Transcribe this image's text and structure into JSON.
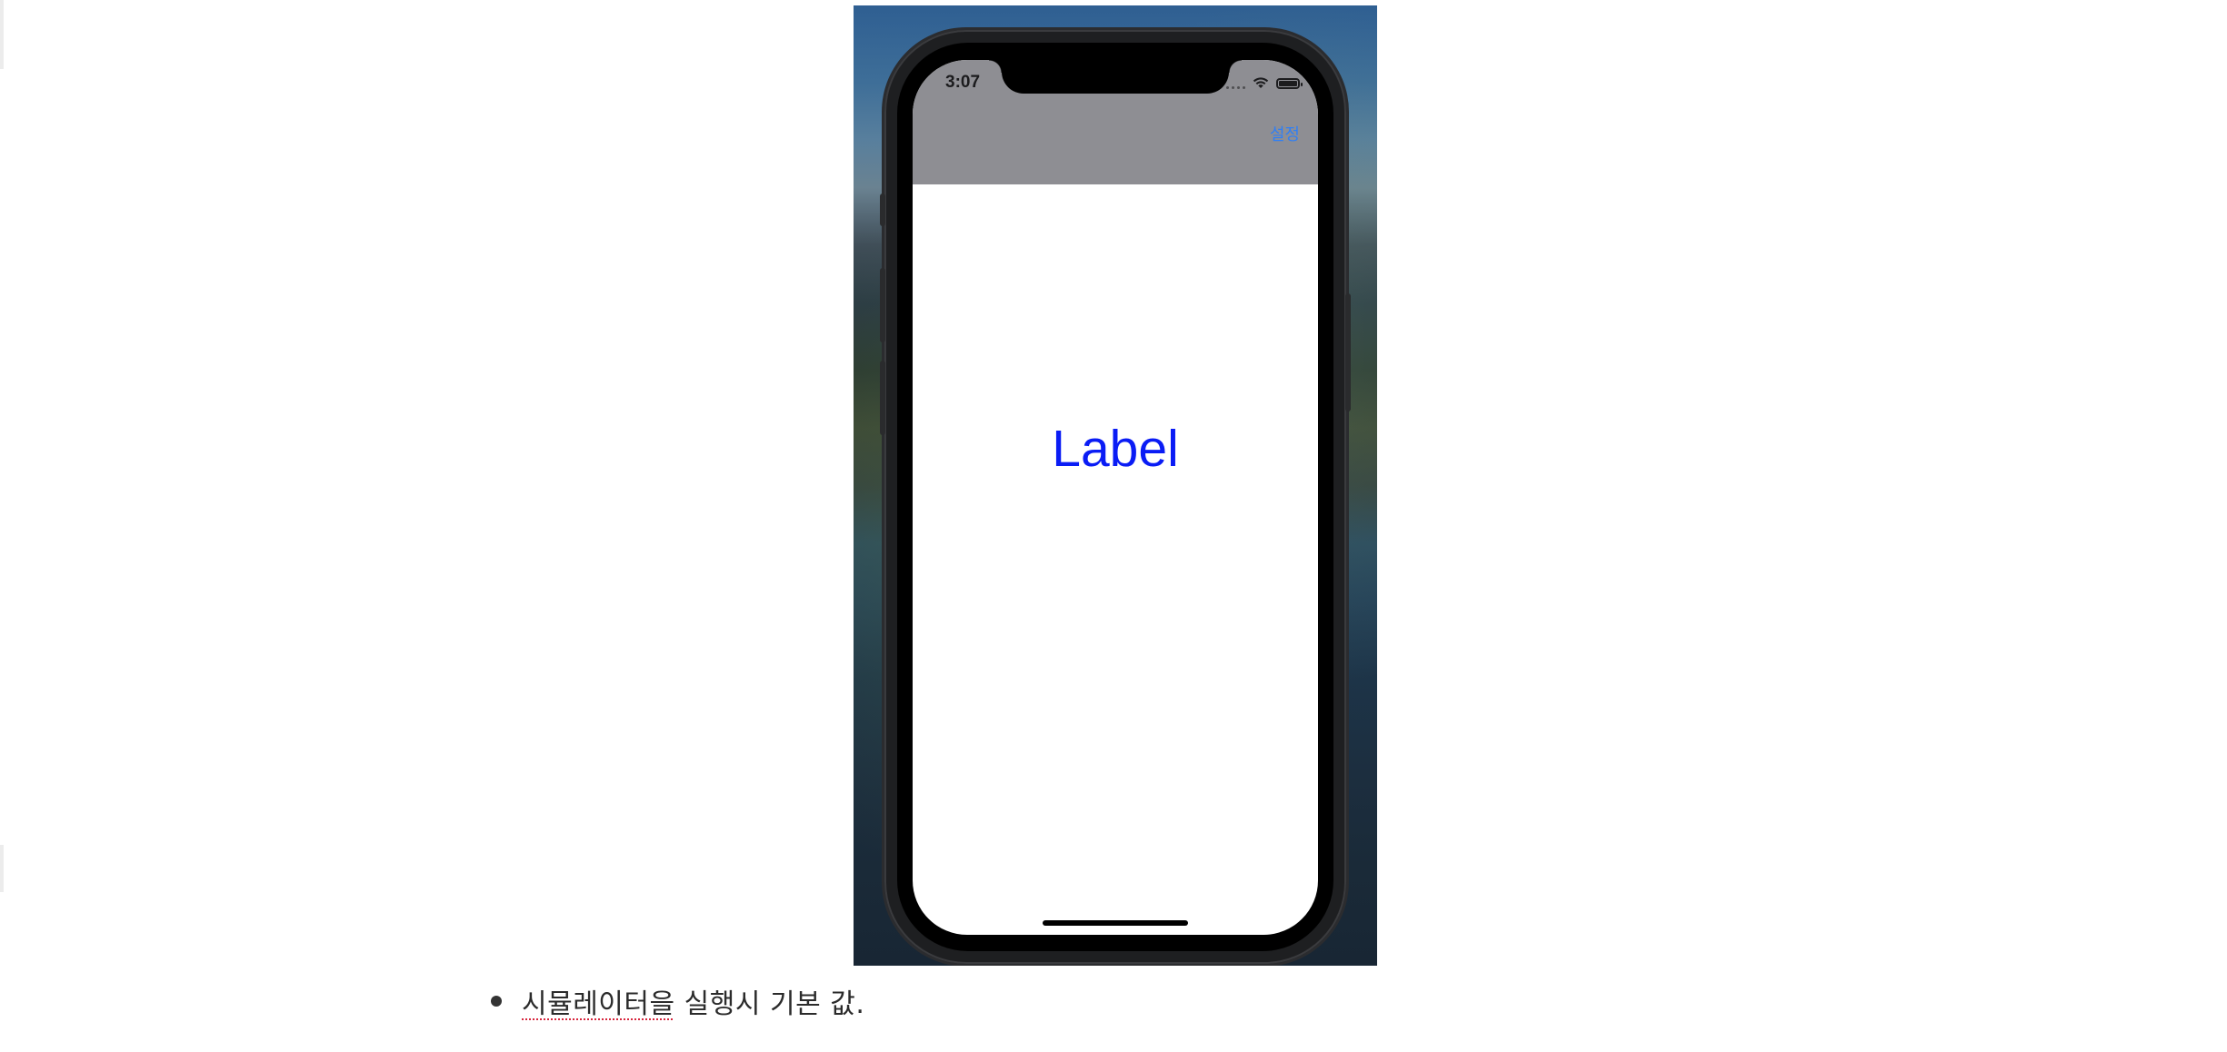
{
  "simulator": {
    "status_time": "3:07",
    "nav_button_label": "설정",
    "center_label": "Label",
    "icons": [
      "signal-dots-icon",
      "wifi-icon",
      "battery-icon"
    ],
    "battery_level": 1.0,
    "colors": {
      "nav_background": "#8e8e93",
      "nav_button": "#2f7ff5",
      "label_text": "#0a1cf5",
      "screen_background": "#ffffff"
    }
  },
  "caption": {
    "flagged_word": "시뮬레이터을",
    "rest": " 실행시 기본 값."
  }
}
